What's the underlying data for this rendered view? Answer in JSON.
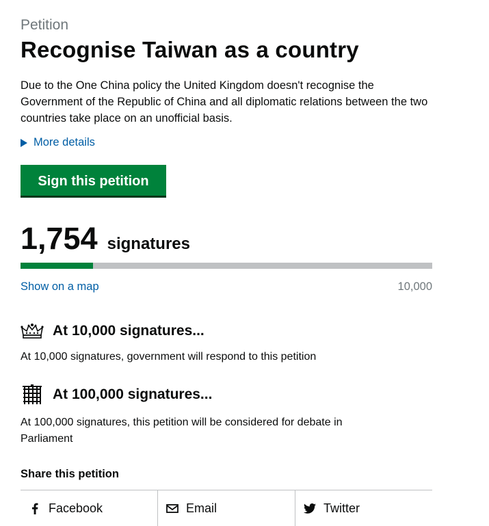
{
  "petition": {
    "kicker": "Petition",
    "title": "Recognise Taiwan as a country",
    "summary": "Due to the One China policy the United Kingdom doesn't recognise the Government of the Republic of China and all diplomatic relations between the two countries take place on an unofficial basis.",
    "more_details": "More details"
  },
  "sign_button": "Sign this petition",
  "signatures": {
    "count": "1,754",
    "label": "signatures",
    "show_map": "Show on a map",
    "target": "10,000",
    "progress_fraction": 0.1754
  },
  "thresholds": [
    {
      "icon": "crown-icon",
      "title": "At 10,000 signatures...",
      "text": "At 10,000 signatures, government will respond to this petition"
    },
    {
      "icon": "portcullis-icon",
      "title": "At 100,000 signatures...",
      "text": "At 100,000 signatures, this petition will be considered for debate in Parliament"
    }
  ],
  "share": {
    "title": "Share this petition",
    "items": [
      {
        "icon": "facebook-icon",
        "label": "Facebook"
      },
      {
        "icon": "email-icon",
        "label": "Email"
      },
      {
        "icon": "twitter-icon",
        "label": "Twitter"
      }
    ]
  },
  "colors": {
    "primary": "#00823b",
    "link": "#005ea5",
    "muted": "#6f777b",
    "bar_track": "#bfc1c3",
    "text": "#0b0c0c"
  }
}
